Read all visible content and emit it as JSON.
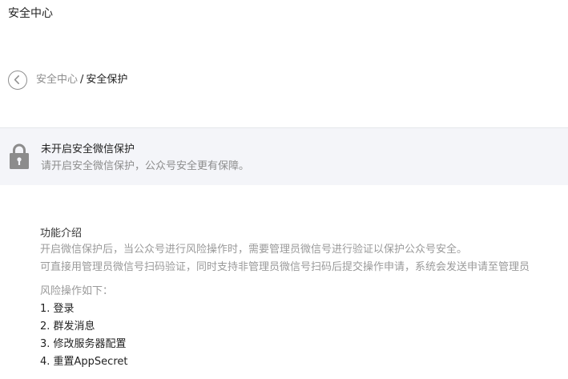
{
  "header": {
    "title": "安全中心"
  },
  "breadcrumb": {
    "parent": "安全中心",
    "separator": "/",
    "current": "安全保护",
    "back_icon": "chevron-left-circle-icon"
  },
  "notice": {
    "icon": "lock-icon",
    "title": "未开启安全微信保护",
    "description": "请开启安全微信保护，公众号安全更有保障。"
  },
  "intro": {
    "title": "功能介绍",
    "lines": [
      "开启微信保护后，当公众号进行风险操作时，需要管理员微信号进行验证以保护公众号安全。",
      "可直接用管理员微信号扫码验证，同时支持非管理员微信号扫码后提交操作申请，系统会发送申请至管理员"
    ],
    "risk_heading": "风险操作如下：",
    "risk_items": [
      "1. 登录",
      "2. 群发消息",
      "3. 修改服务器配置",
      "4. 重置AppSecret"
    ]
  },
  "colors": {
    "notice_background": "#f4f5f9",
    "muted_text": "#8d8d8d",
    "primary_text": "#222222"
  }
}
